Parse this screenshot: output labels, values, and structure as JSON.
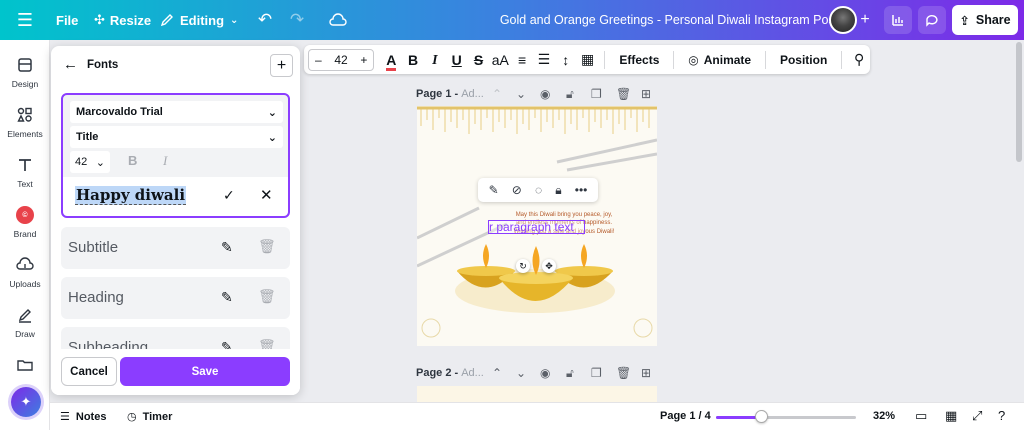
{
  "topbar": {
    "file": "File",
    "resize": "Resize",
    "editing": "Editing",
    "title": "Gold and Orange Greetings - Personal Diwali Instagram Post",
    "share": "Share"
  },
  "rail": {
    "items": [
      {
        "label": "Design",
        "icon": "design-icon"
      },
      {
        "label": "Elements",
        "icon": "elements-icon"
      },
      {
        "label": "Text",
        "icon": "text-icon"
      },
      {
        "label": "Brand",
        "icon": "brand-icon"
      },
      {
        "label": "Uploads",
        "icon": "uploads-icon"
      },
      {
        "label": "Draw",
        "icon": "draw-icon"
      }
    ]
  },
  "toolbar": {
    "font_size": "42",
    "effects": "Effects",
    "animate": "Animate",
    "position": "Position"
  },
  "panel": {
    "title": "Fonts",
    "font_family": "Marcovaldo Trial",
    "text_style": "Title",
    "size": "42",
    "bold": "B",
    "italic": "I",
    "preview": "Happy diwali",
    "styles": [
      "Subtitle",
      "Heading",
      "Subheading"
    ],
    "cancel": "Cancel",
    "save": "Save"
  },
  "pages": {
    "page1_label": "Page 1 -",
    "page1_placeholder": "Ad...",
    "page2_label": "Page 2 -",
    "page2_placeholder": "Ad..."
  },
  "design": {
    "small_text": "May this Diwali bring you peace, joy, and endless moments of happiness. Wishing you a safe and joyous Diwali!",
    "paragraph": "r paragraph text"
  },
  "bottombar": {
    "notes": "Notes",
    "timer": "Timer",
    "page_count": "Page 1 / 4",
    "zoom": "32%",
    "zoom_fraction": 0.32
  },
  "colors": {
    "accent": "#8b3dff",
    "gradient_start": "#00c4cc",
    "gradient_end": "#7d2ae8"
  }
}
